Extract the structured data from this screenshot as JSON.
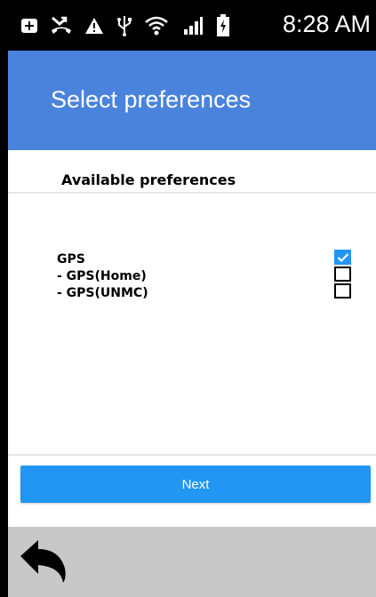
{
  "status_bar": {
    "time": "8:28 AM",
    "icons": [
      "notification-icon",
      "missed-call-icon",
      "warning-icon",
      "usb-icon",
      "wifi-icon",
      "signal-icon",
      "battery-icon"
    ]
  },
  "header": {
    "title": "Select preferences",
    "color": "#4a83dc"
  },
  "section": {
    "label": "Available preferences"
  },
  "preferences": [
    {
      "label": "GPS",
      "checked": true
    },
    {
      "label": "- GPS(Home)",
      "checked": false
    },
    {
      "label": "- GPS(UNMC)",
      "checked": false
    }
  ],
  "actions": {
    "next_label": "Next",
    "accent": "#2196f3"
  },
  "nav": {
    "back_icon": "back-arrow-icon"
  }
}
